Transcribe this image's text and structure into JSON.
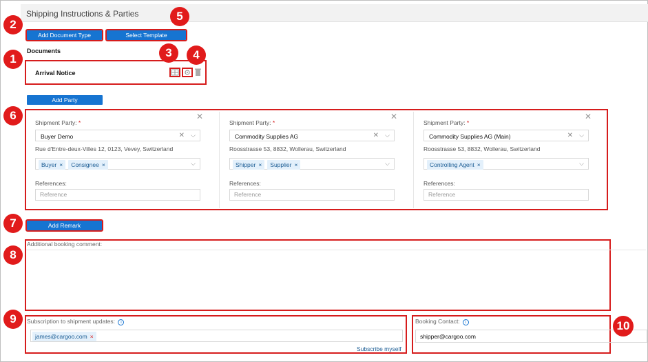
{
  "header": {
    "title": "Shipping Instructions & Parties"
  },
  "buttons": {
    "add_document_type": "Add Document Type",
    "select_template": "Select Template",
    "add_party": "Add Party",
    "add_remark": "Add Remark"
  },
  "documents": {
    "heading": "Documents",
    "items": [
      {
        "name": "Arrival Notice"
      }
    ]
  },
  "parties": {
    "field_label": "Shipment Party:",
    "required_mark": "*",
    "references_label": "References:",
    "reference_placeholder": "Reference",
    "columns": [
      {
        "party": "Buyer Demo",
        "address": "Rue d'Entre-deux-Villes 12, 0123, Vevey, Switzerland",
        "roles": [
          "Buyer",
          "Consignee"
        ]
      },
      {
        "party": "Commodity Supplies AG",
        "address": "Roosstrasse 53, 8832, Wollerau, Switzerland",
        "roles": [
          "Shipper",
          "Supplier"
        ]
      },
      {
        "party": "Commodity Supplies AG (Main)",
        "address": "Roosstrasse 53, 8832, Wollerau, Switzerland",
        "roles": [
          "Controlling Agent"
        ]
      }
    ]
  },
  "remark": {
    "label": "Additional booking comment:"
  },
  "subscription": {
    "label": "Subscription to shipment updates:",
    "emails": [
      "james@cargoo.com"
    ],
    "subscribe_link": "Subscribe myself"
  },
  "booking_contact": {
    "label": "Booking Contact:",
    "value": "shipper@cargoo.com"
  },
  "callouts": [
    "1",
    "2",
    "3",
    "4",
    "5",
    "6",
    "7",
    "8",
    "9",
    "10"
  ],
  "colors": {
    "accent": "#1674d1",
    "highlight": "#d61c1c",
    "chip_bg": "#e3f0fb"
  }
}
